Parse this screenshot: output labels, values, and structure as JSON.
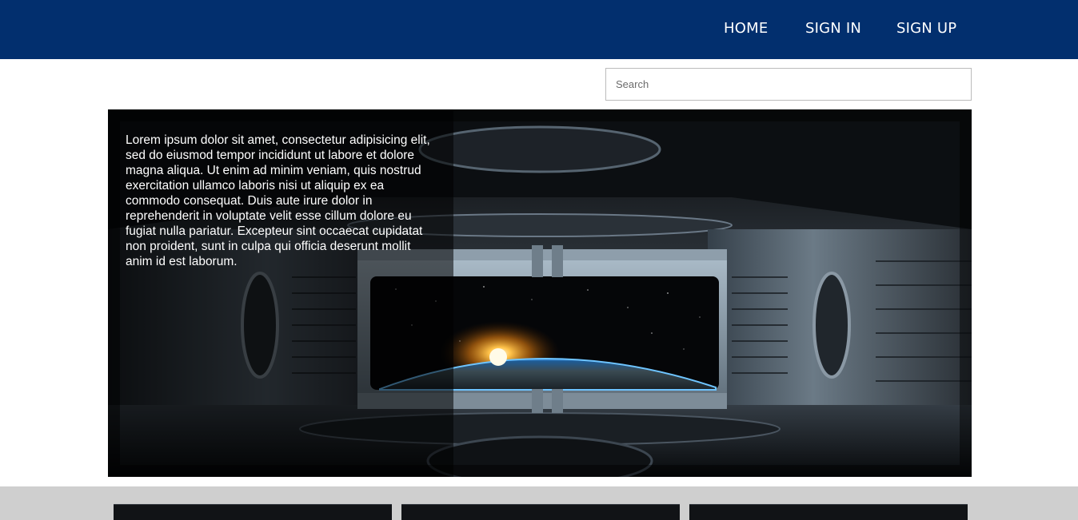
{
  "nav": {
    "links": [
      {
        "label": "HOME"
      },
      {
        "label": "SIGN IN"
      },
      {
        "label": "SIGN UP"
      }
    ],
    "background_color": "#022f6e"
  },
  "search": {
    "placeholder": "Search",
    "value": ""
  },
  "hero": {
    "text": "Lorem ipsum dolor sit amet, consectetur adipisicing elit, sed do eiusmod tempor incididunt ut labore et dolore magna aliqua. Ut enim ad minim veniam, quis nostrud exercitation ullamco laboris nisi ut aliquip ex ea commodo consequat. Duis aute irure dolor in reprehenderit in voluptate velit esse cillum dolore eu fugiat nulla pariatur. Excepteur sint occaecat cupidatat non proident, sunt in culpa qui officia deserunt mollit anim id est laborum.",
    "image": "spaceship-window-earth-sunrise"
  },
  "cards_section": {
    "background_color": "#cfcfcf",
    "cards": [
      {
        "image": "spaceship-interior-thumbnail"
      },
      {
        "image": "spaceship-interior-thumbnail"
      },
      {
        "image": "spaceship-interior-thumbnail"
      }
    ]
  }
}
